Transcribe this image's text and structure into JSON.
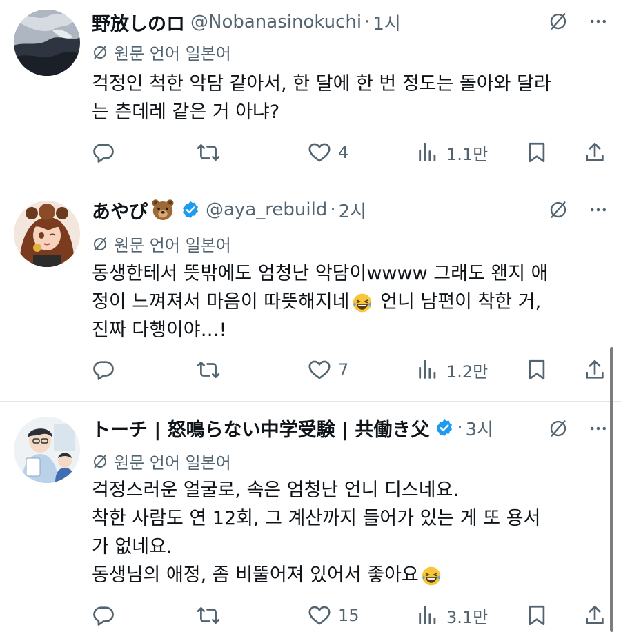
{
  "translate_label": "원문 언어 일본어",
  "tweets": [
    {
      "name": "野放しのロ",
      "handle": "@Nobanasinokuchi",
      "time": "1시",
      "verified": false,
      "emoji": "",
      "lines": [
        "걱정인 척한 악담 같아서, 한 달에 한 번 정도는 돌아와 달라",
        "는 츤데레 같은 거 아냐?"
      ],
      "stats": {
        "reply": "",
        "retweet": "",
        "like": "4",
        "views": "1.1만"
      }
    },
    {
      "name": "あやぴ",
      "handle": "@aya_rebuild",
      "time": "2시",
      "verified": true,
      "emoji": "bear-face",
      "lines": [
        "동생한테서 뜻밖에도 엄청난 악담이wwww 그래도 왠지 애",
        "정이 느껴져서 마음이 따뜻해지네",
        "진짜 다행이야…!"
      ],
      "line2_tail": " 언니 남편이 착한 거,",
      "stats": {
        "reply": "",
        "retweet": "",
        "like": "7",
        "views": "1.2만"
      }
    },
    {
      "name": "トーチ | 怒鳴らない中学受験 | 共働き父",
      "handle": "",
      "time": "3시",
      "verified": true,
      "emoji": "",
      "lines": [
        "걱정스러운 얼굴로, 속은 엄청난 언니 디스네요.",
        "착한 사람도 연 12회, 그 계산까지 들어가 있는 게 또 용서",
        "가 없네요.",
        "동생님의 애정, 좀 비뚤어져 있어서 좋아요"
      ],
      "stats": {
        "reply": "",
        "retweet": "",
        "like": "15",
        "views": "3.1만"
      }
    }
  ],
  "colors": {
    "text": "#0f1419",
    "secondary": "#536471",
    "verified": "#1d9bf0",
    "divider": "#e6e9ec"
  }
}
